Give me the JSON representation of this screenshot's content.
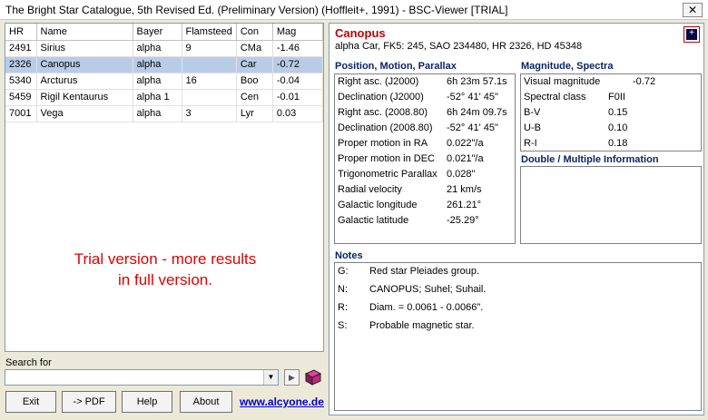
{
  "window": {
    "title": "The Bright Star Catalogue, 5th Revised Ed. (Preliminary Version) (Hoffleit+, 1991) - BSC-Viewer [TRIAL]",
    "close_glyph": "✕"
  },
  "table": {
    "columns": [
      "HR",
      "Name",
      "Bayer",
      "Flamsteed",
      "Con",
      "Mag"
    ],
    "rows": [
      {
        "hr": "2491",
        "name": "Sirius",
        "bayer": "alpha",
        "flamsteed": "9",
        "con": "CMa",
        "mag": "-1.46"
      },
      {
        "hr": "2326",
        "name": "Canopus",
        "bayer": "alpha",
        "flamsteed": "",
        "con": "Car",
        "mag": "-0.72"
      },
      {
        "hr": "5340",
        "name": "Arcturus",
        "bayer": "alpha",
        "flamsteed": "16",
        "con": "Boo",
        "mag": "-0.04"
      },
      {
        "hr": "5459",
        "name": "Rigil Kentaurus",
        "bayer": "alpha 1",
        "flamsteed": "",
        "con": "Cen",
        "mag": "-0.01"
      },
      {
        "hr": "7001",
        "name": "Vega",
        "bayer": "alpha",
        "flamsteed": "3",
        "con": "Lyr",
        "mag": "0.03"
      }
    ],
    "trial_line1": "Trial version - more results",
    "trial_line2": "in full version."
  },
  "search": {
    "label": "Search for",
    "value": "",
    "dropdown_glyph": "▼",
    "go_glyph": "▶"
  },
  "buttons": {
    "exit": "Exit",
    "pdf": "-> PDF",
    "help": "Help",
    "about": "About"
  },
  "link": "www.alcyone.de",
  "star": {
    "name": "Canopus",
    "ids": "alpha  Car, FK5: 245, SAO 234480, HR 2326, HD 45348",
    "thumb_glyph": "+"
  },
  "position": {
    "title": "Position, Motion, Parallax",
    "rows": [
      {
        "k": "Right asc. (J2000)",
        "v": "6h 23m 57.1s"
      },
      {
        "k": "Declination (J2000)",
        "v": "-52° 41' 45\""
      },
      {
        "k": "Right asc. (2008.80)",
        "v": "6h 24m 09.7s"
      },
      {
        "k": "Declination (2008.80)",
        "v": "-52° 41' 45\""
      },
      {
        "k": "Proper motion in RA",
        "v": "0.022\"/a"
      },
      {
        "k": "Proper motion in DEC",
        "v": "0.021\"/a"
      },
      {
        "k": "Trigonometric Parallax",
        "v": "0.028\""
      },
      {
        "k": "Radial velocity",
        "v": "21 km/s"
      },
      {
        "k": "Galactic longitude",
        "v": "261.21°"
      },
      {
        "k": "Galactic latitude",
        "v": "-25.29°"
      }
    ]
  },
  "magnitude": {
    "title": "Magnitude, Spectra",
    "rows": [
      {
        "k": "Visual magnitude",
        "v": "-0.72"
      },
      {
        "k": "Spectral class",
        "v": "F0II"
      },
      {
        "k": "B-V",
        "v": "0.15"
      },
      {
        "k": "U-B",
        "v": "0.10"
      },
      {
        "k": "R-I",
        "v": "0.18"
      }
    ]
  },
  "double": {
    "title": "Double / Multiple Information"
  },
  "notes": {
    "title": "Notes",
    "rows": [
      {
        "k": "G:",
        "v": "Red star Pleiades group."
      },
      {
        "k": "N:",
        "v": "CANOPUS; Suhel; Suhail."
      },
      {
        "k": "R:",
        "v": "Diam. = 0.0061 - 0.0066\"."
      },
      {
        "k": "S:",
        "v": "Probable magnetic star."
      }
    ]
  }
}
